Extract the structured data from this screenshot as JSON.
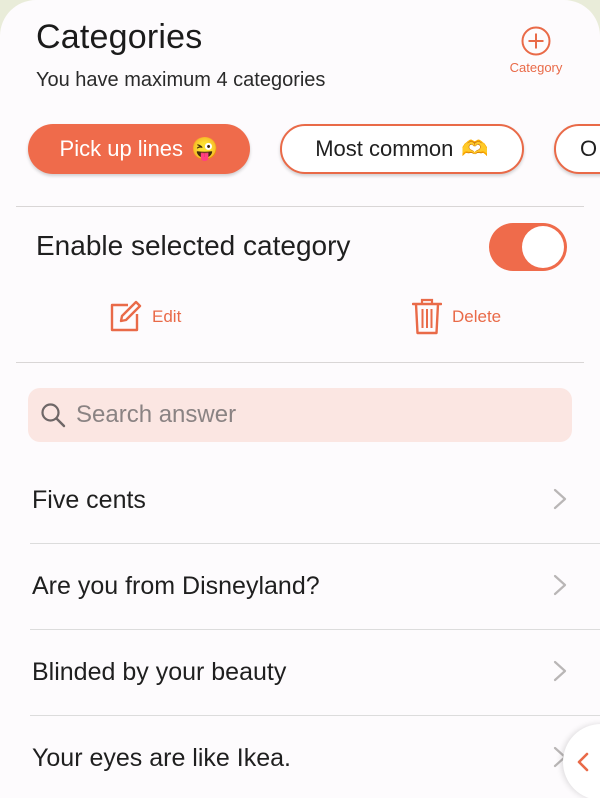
{
  "header": {
    "title": "Categories",
    "subtitle": "You have maximum 4 categories",
    "add_category_label": "Category",
    "add_icon": "plus-circle-icon"
  },
  "categories": [
    {
      "label": "Pick up lines",
      "emoji": "😜",
      "active": true
    },
    {
      "label": "Most common",
      "emoji": "🫶",
      "active": false
    },
    {
      "label": "O",
      "emoji": "",
      "active": false
    }
  ],
  "category_settings": {
    "enable_label": "Enable selected category",
    "enabled": true,
    "edit_label": "Edit",
    "delete_label": "Delete"
  },
  "search": {
    "placeholder": "Search answer",
    "value": ""
  },
  "answers": [
    {
      "text": "Five cents"
    },
    {
      "text": "Are you from Disneyland?"
    },
    {
      "text": "Blinded by your beauty"
    },
    {
      "text": "Your eyes are like Ikea."
    }
  ],
  "colors": {
    "accent": "#ef6b4b",
    "search_bg": "#fbe6e2",
    "background": "#fdfbfd"
  }
}
